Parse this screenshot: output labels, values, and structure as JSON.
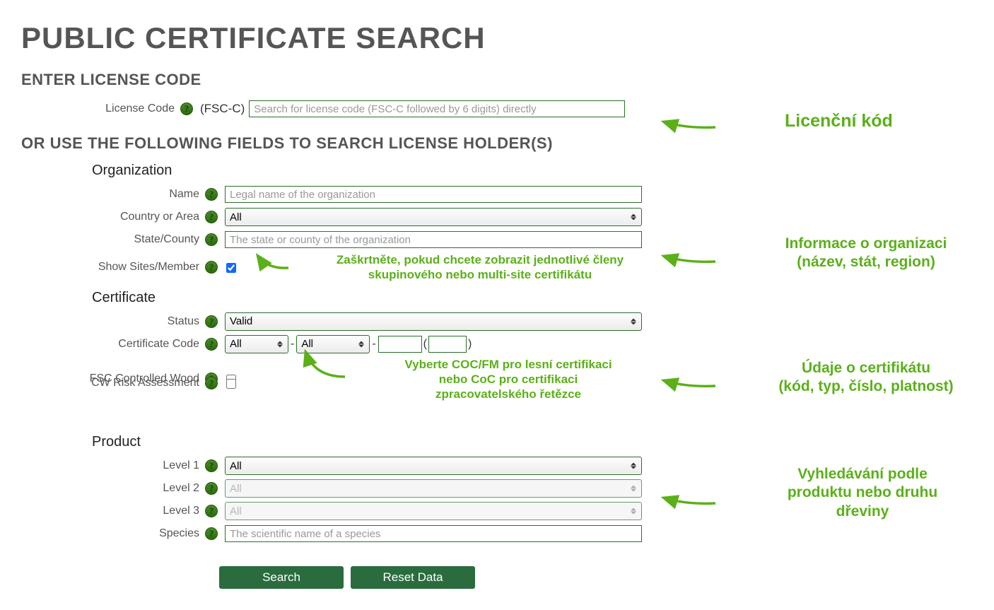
{
  "title": "PUBLIC CERTIFICATE SEARCH",
  "section_license": "ENTER LICENSE CODE",
  "section_or": "OR USE THE FOLLOWING FIELDS TO SEARCH LICENSE HOLDER(S)",
  "license": {
    "label": "License Code",
    "prefix": "(FSC-C)",
    "placeholder": "Search for license code (FSC-C followed by 6 digits) directly"
  },
  "sub_org": "Organization",
  "org": {
    "name_label": "Name",
    "name_placeholder": "Legal name of the organization",
    "country_label": "Country or Area",
    "country_value": "All",
    "state_label": "State/County",
    "state_placeholder": "The state or county of the organization",
    "show_sites_label": "Show Sites/Member"
  },
  "sub_cert": "Certificate",
  "cert": {
    "status_label": "Status",
    "status_value": "Valid",
    "code_label": "Certificate Code",
    "code_sel1": "All",
    "code_sel2": "All",
    "controlled_label": "FSC Controlled Wood",
    "cw_risk_label": "CW Risk Assessment"
  },
  "sub_product": "Product",
  "product": {
    "l1_label": "Level 1",
    "l1_value": "All",
    "l2_label": "Level 2",
    "l2_value": "All",
    "l3_label": "Level 3",
    "l3_value": "All",
    "species_label": "Species",
    "species_placeholder": "The scientific name of a species"
  },
  "buttons": {
    "search": "Search",
    "reset": "Reset Data"
  },
  "annotations": {
    "license": "Licenční kód",
    "org_l1": "Informace o organizaci",
    "org_l2": "(název, stát, region)",
    "sites_l1": "Zaškrtněte, pokud chcete zobrazit jednotlivé členy",
    "sites_l2": "skupinového nebo multi-site certifikátu",
    "cert_l1": "Údaje o certifikátu",
    "cert_l2": "(kód, typ, číslo, platnost)",
    "coc_l1": "Vyberte COC/FM pro lesní certifikaci",
    "coc_l2": "nebo CoC pro certifikaci",
    "coc_l3": "zpracovatelského řetězce",
    "prod_l1": "Vyhledávání podle",
    "prod_l2": "produktu nebo druhu",
    "prod_l3": "dřeviny"
  },
  "help_glyph": "?"
}
